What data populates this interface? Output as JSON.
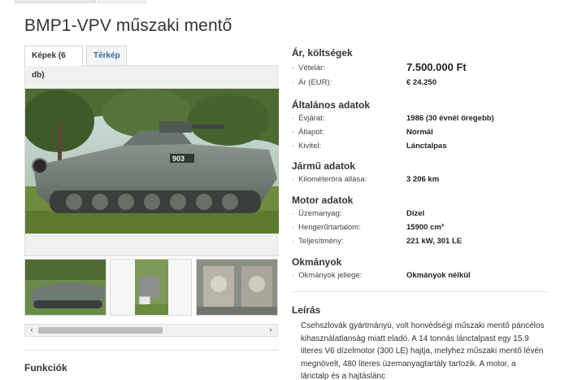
{
  "title": "BMP1-VPV műszaki mentő",
  "tabs": [
    {
      "label": "Képek (6 db)"
    },
    {
      "label": "Térkép"
    }
  ],
  "scrollbar": {
    "left_arrow": "‹",
    "right_arrow": "›"
  },
  "sections": {
    "costs": {
      "heading": "Ár, költségek",
      "rows": [
        {
          "label": "Vételár:",
          "value": "7.500.000 Ft"
        },
        {
          "label": "Ár (EUR):",
          "value": "€ 24.250"
        }
      ]
    },
    "general": {
      "heading": "Általános adatok",
      "rows": [
        {
          "label": "Évjárat:",
          "value": "1986 (30 évnél öregebb)"
        },
        {
          "label": "Állapot:",
          "value": "Normál"
        },
        {
          "label": "Kivitel:",
          "value": "Lánctalpas"
        }
      ]
    },
    "vehicle": {
      "heading": "Jármű adatok",
      "rows": [
        {
          "label": "Kilométeróra állása:",
          "value": "3 206 km"
        }
      ]
    },
    "engine": {
      "heading": "Motor adatok",
      "rows": [
        {
          "label": "Üzemanyag:",
          "value": "Dízel"
        },
        {
          "label": "Hengerűrtartalom:",
          "value": "15900 cm³"
        },
        {
          "label": "Teljesítmény:",
          "value": "221 kW, 301 LE"
        }
      ]
    },
    "documents": {
      "heading": "Okmányok",
      "rows": [
        {
          "label": "Okmányok jellege:",
          "value": "Okmányok nélkül"
        }
      ]
    }
  },
  "description": {
    "heading": "Leírás",
    "text": "Csehszlovák gyártmányú, volt honvédségi műszaki mentő páncélos kihasználatlanság miatt eladó. A 14 tonnás lánctalpast egy 15.9 literes V6 dízelmotor (300 LE) hajtja, melyhez műszaki mentő lévén megnövelt, 480 literes üzemanyagtartály tartozik. A motor, a lánctalp és a hajtáslánc"
  },
  "features": {
    "heading": "Funkciók"
  },
  "photo": {
    "hull_number": "903"
  }
}
